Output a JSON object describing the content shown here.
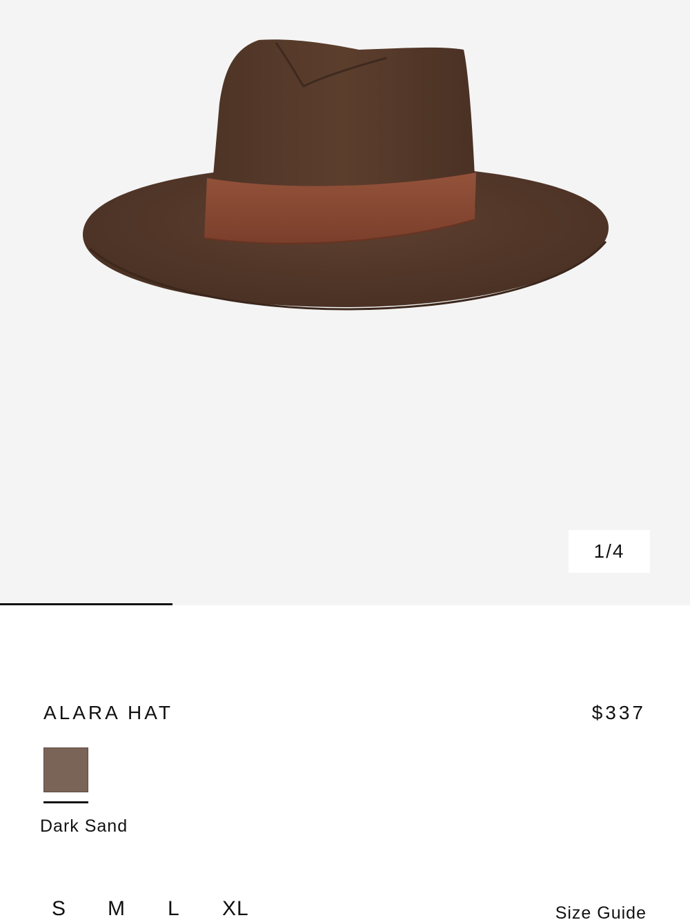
{
  "gallery": {
    "image_alt": "Alara Hat",
    "counter": "1/4",
    "current_index": 1,
    "total_images": 4,
    "progress_fraction": 0.25
  },
  "product": {
    "name": "ALARA HAT",
    "price": "$337"
  },
  "color": {
    "selected_name": "Dark Sand",
    "swatch_color": "#7a6457"
  },
  "sizes": {
    "options": [
      "S",
      "M",
      "L",
      "XL"
    ],
    "guide_label": "Size Guide"
  }
}
